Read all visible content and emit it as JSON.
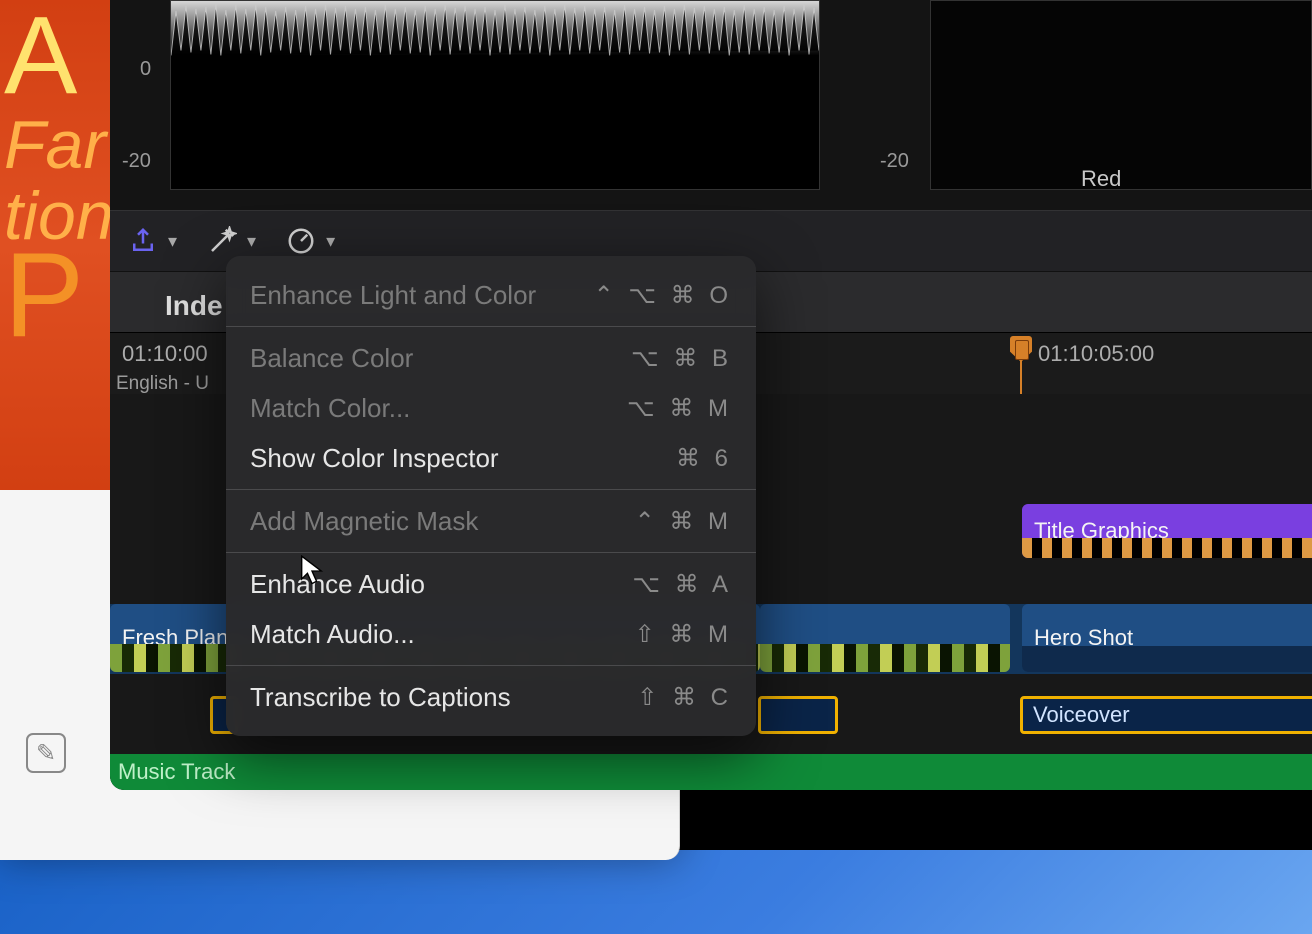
{
  "scopes": {
    "db0": "0",
    "dbm20": "-20",
    "channel_label": "Red"
  },
  "subbar": {
    "index_label": "Inde"
  },
  "ruler": {
    "tc_left": "01:10:00",
    "lang_left": "English - U",
    "tc_right": "01:10:05:00"
  },
  "clips": {
    "title_graphics": "Title Graphics",
    "fresh_plan": "Fresh Plan",
    "hero_shot": "Hero Shot",
    "voiceover": "Voiceover",
    "music_track": "Music Track"
  },
  "menu": {
    "items": [
      {
        "label": "Enhance Light and Color",
        "shortcut": "⌃ ⌥ ⌘ O",
        "enabled": false
      },
      {
        "sep": true
      },
      {
        "label": "Balance Color",
        "shortcut": "⌥ ⌘ B",
        "enabled": false
      },
      {
        "label": "Match Color...",
        "shortcut": "⌥ ⌘ M",
        "enabled": false
      },
      {
        "label": "Show Color Inspector",
        "shortcut": "⌘ 6",
        "enabled": true
      },
      {
        "sep": true
      },
      {
        "label": "Add Magnetic Mask",
        "shortcut": "⌃ ⌘ M",
        "enabled": false
      },
      {
        "sep": true
      },
      {
        "label": "Enhance Audio",
        "shortcut": "⌥ ⌘ A",
        "enabled": true
      },
      {
        "label": "Match Audio...",
        "shortcut": "⇧ ⌘ M",
        "enabled": true
      },
      {
        "sep": true
      },
      {
        "label": "Transcribe to Captions",
        "shortcut": "⇧ ⌘ C",
        "enabled": true
      }
    ]
  },
  "art": {
    "s1": "A",
    "s2": "Far",
    "s3": "tion",
    "s4": "P"
  },
  "doc_pencil": "✎"
}
